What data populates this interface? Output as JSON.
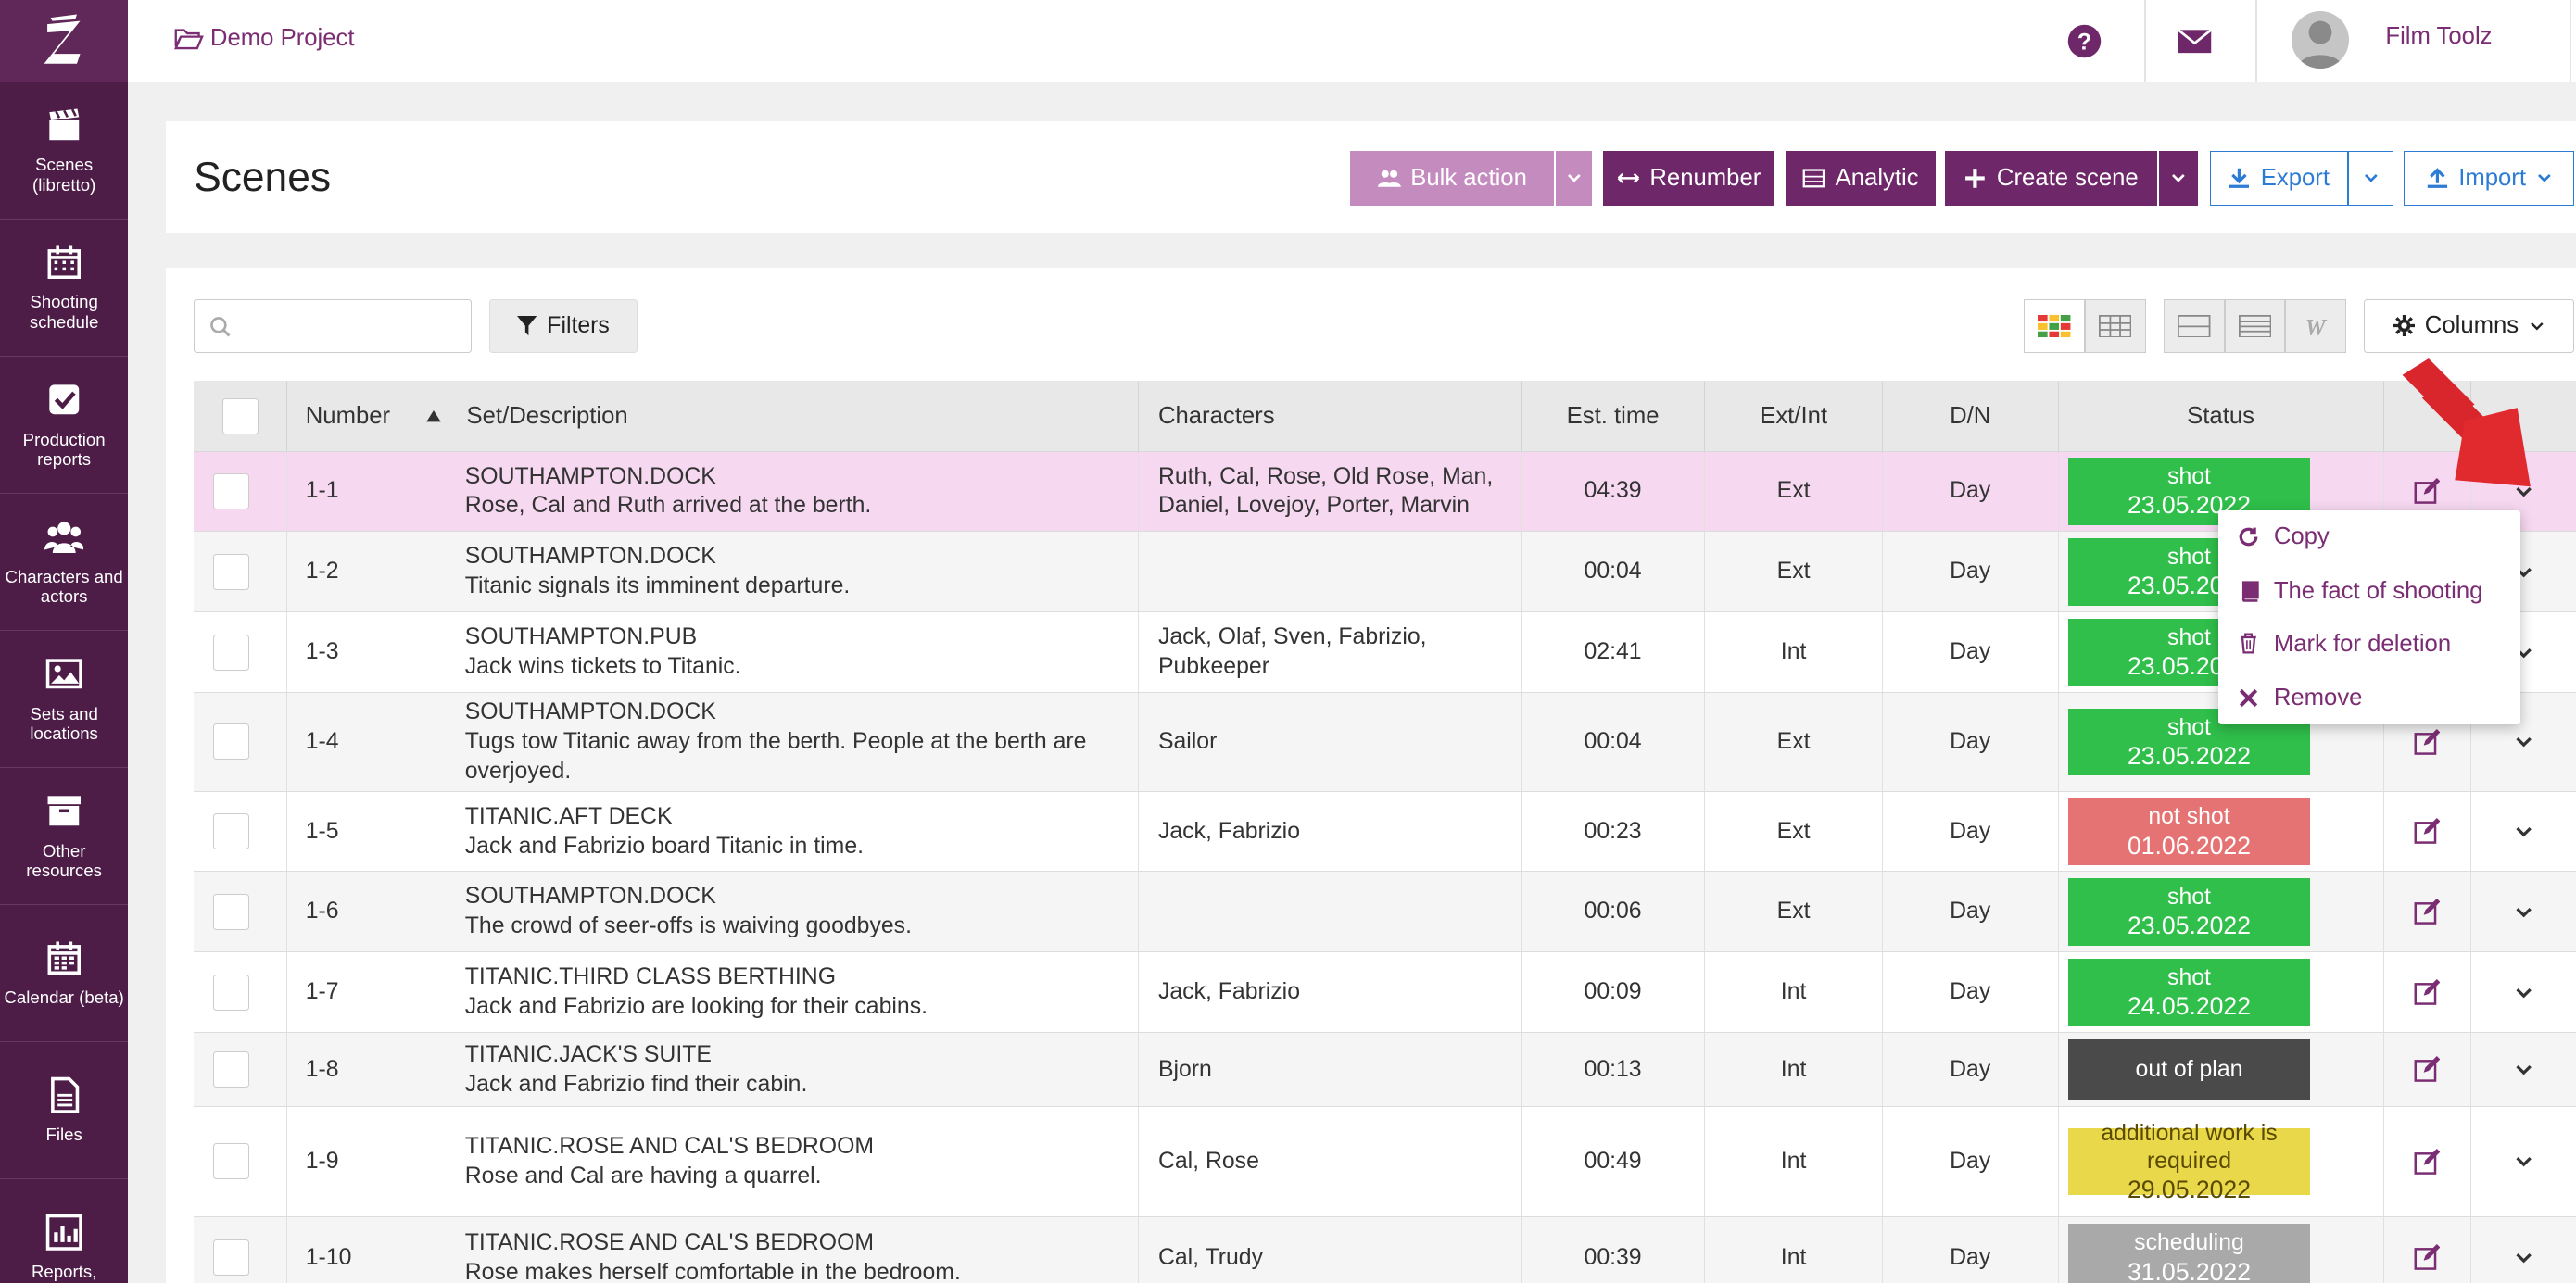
{
  "sidebar": {
    "items": [
      {
        "label": "Scenes (libretto)",
        "icon": "clapperboard-icon"
      },
      {
        "label": "Shooting schedule",
        "icon": "calendar-icon"
      },
      {
        "label": "Production reports",
        "icon": "check-square-icon"
      },
      {
        "label": "Characters and actors",
        "icon": "users-icon"
      },
      {
        "label": "Sets and locations",
        "icon": "image-icon"
      },
      {
        "label": "Other resources",
        "icon": "archive-icon"
      },
      {
        "label": "Calendar (beta)",
        "icon": "calendar-grid-icon"
      },
      {
        "label": "Files",
        "icon": "file-icon"
      },
      {
        "label": "Reports,",
        "icon": "bar-chart-icon"
      }
    ]
  },
  "topbar": {
    "project": "Demo Project",
    "user": "Film Toolz"
  },
  "page": {
    "title": "Scenes"
  },
  "toolbar": {
    "bulk": "Bulk action",
    "renumber": "Renumber",
    "analytic": "Analytic",
    "create": "Create scene",
    "export": "Export",
    "import": "Import"
  },
  "filters": {
    "label": "Filters",
    "search_placeholder": ""
  },
  "columns_label": "Columns",
  "table": {
    "headers": {
      "number": "Number",
      "set": "Set/Description",
      "characters": "Characters",
      "time": "Est. time",
      "extint": "Ext/Int",
      "dn": "D/N",
      "status": "Status"
    },
    "rows": [
      {
        "number": "1-1",
        "set": "SOUTHAMPTON.DOCK",
        "desc": "Rose, Cal and Ruth arrived at the berth.",
        "chars": "Ruth, Cal, Rose, Old Rose, Man, Daniel, Lovejoy, Porter, Marvin",
        "time": "04:39",
        "extint": "Ext",
        "dn": "Day",
        "status": "shot",
        "date": "23.05.2022",
        "color": "#2fbf4a"
      },
      {
        "number": "1-2",
        "set": "SOUTHAMPTON.DOCK",
        "desc": "Titanic signals its imminent departure.",
        "chars": "",
        "time": "00:04",
        "extint": "Ext",
        "dn": "Day",
        "status": "shot",
        "date": "23.05.2022",
        "color": "#2fbf4a"
      },
      {
        "number": "1-3",
        "set": "SOUTHAMPTON.PUB",
        "desc": "Jack wins tickets to Titanic.",
        "chars": "Jack, Olaf, Sven, Fabrizio, Pubkeeper",
        "time": "02:41",
        "extint": "Int",
        "dn": "Day",
        "status": "shot",
        "date": "23.05.2022",
        "color": "#2fbf4a"
      },
      {
        "number": "1-4",
        "set": "SOUTHAMPTON.DOCK",
        "desc": "Tugs tow Titanic away from the berth. People at the berth are overjoyed.",
        "chars": "Sailor",
        "time": "00:04",
        "extint": "Ext",
        "dn": "Day",
        "status": "shot",
        "date": "23.05.2022",
        "color": "#2fbf4a"
      },
      {
        "number": "1-5",
        "set": "TITANIC.AFT DECK",
        "desc": "Jack and Fabrizio board Titanic in time.",
        "chars": "Jaсk, Fabrizio",
        "time": "00:23",
        "extint": "Ext",
        "dn": "Day",
        "status": "not shot",
        "date": "01.06.2022",
        "color": "#e57373"
      },
      {
        "number": "1-6",
        "set": "SOUTHAMPTON.DOCK",
        "desc": "The crowd of seer-offs is waiving goodbyes.",
        "chars": "",
        "time": "00:06",
        "extint": "Ext",
        "dn": "Day",
        "status": "shot",
        "date": "23.05.2022",
        "color": "#2fbf4a"
      },
      {
        "number": "1-7",
        "set": "TITANIC.THIRD CLASS BERTHING",
        "desc": "Jack and Fabrizio are looking for their cabins.",
        "chars": "Jaсk, Fabrizio",
        "time": "00:09",
        "extint": "Int",
        "dn": "Day",
        "status": "shot",
        "date": "24.05.2022",
        "color": "#2fbf4a"
      },
      {
        "number": "1-8",
        "set": "TITANIC.JACK'S SUITE",
        "desc": "Jack and Fabrizio find their cabin.",
        "chars": "Bjorn",
        "time": "00:13",
        "extint": "Int",
        "dn": "Day",
        "status": "out of plan",
        "date": "",
        "color": "#4a4a4a"
      },
      {
        "number": "1-9",
        "set": "TITANIC.ROSE AND CAL'S BEDROOM",
        "desc": "Rose and Cal are having a quarrel.",
        "chars": "Cal, Rose",
        "time": "00:49",
        "extint": "Int",
        "dn": "Day",
        "status": "additional work is required",
        "date": "29.05.2022",
        "color": "#e8d84a"
      },
      {
        "number": "1-10",
        "set": "TITANIC.ROSE AND CAL'S BEDROOM",
        "desc": "Rose makes herself comfortable in the bedroom.",
        "chars": "Cal, Trudy",
        "time": "00:39",
        "extint": "Int",
        "dn": "Day",
        "status": "scheduling",
        "date": "31.05.2022",
        "color": "#a9a9a9"
      }
    ]
  },
  "context_menu": {
    "items": [
      {
        "label": "Copy",
        "icon": "refresh-icon"
      },
      {
        "label": "The fact of shooting",
        "icon": "book-icon"
      },
      {
        "label": "Mark for deletion",
        "icon": "trash-icon"
      },
      {
        "label": "Remove",
        "icon": "x-icon"
      }
    ]
  },
  "colors": {
    "brand": "#6e2769",
    "sidebar": "#4d1d48",
    "accent_blue": "#2c7bd4",
    "selected_row": "#f6d8f1"
  }
}
